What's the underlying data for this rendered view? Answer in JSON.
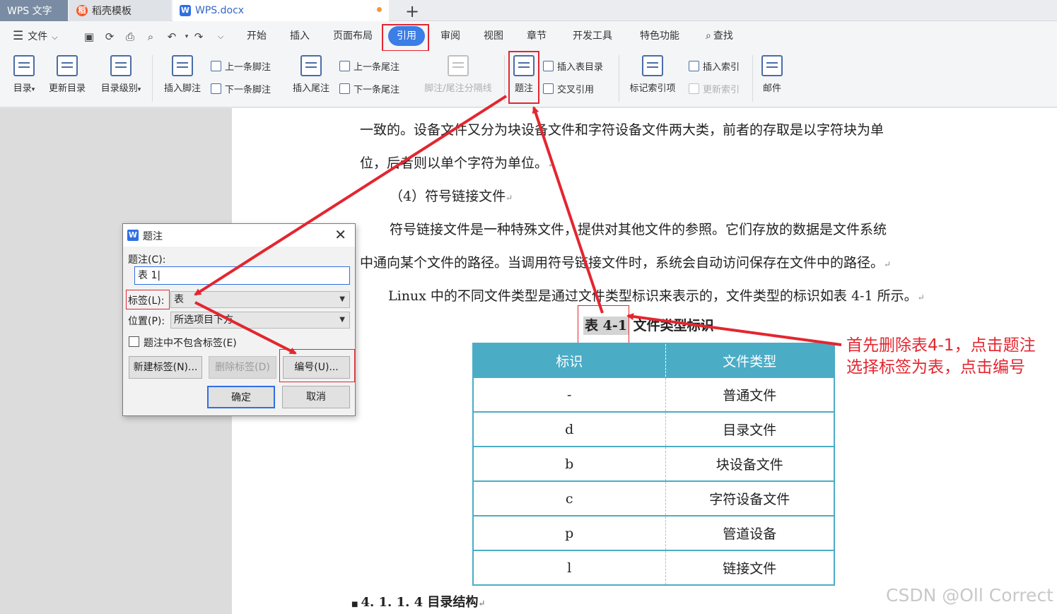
{
  "tabs": [
    {
      "label": "WPS 文字"
    },
    {
      "label": "稻壳模板"
    },
    {
      "label": "WPS.docx"
    }
  ],
  "menu": {
    "file": "文件",
    "items": [
      "开始",
      "插入",
      "页面布局",
      "引用",
      "审阅",
      "视图",
      "章节",
      "开发工具",
      "特色功能",
      "查找"
    ],
    "active": "引用"
  },
  "ribbon": {
    "toc": "目录",
    "update_toc": "更新目录",
    "toc_level": "目录级别",
    "insert_footnote": "插入脚注",
    "prev_footnote": "上一条脚注",
    "next_footnote": "下一条脚注",
    "insert_endnote": "插入尾注",
    "prev_endnote": "上一条尾注",
    "next_endnote": "下一条尾注",
    "separator": "脚注/尾注分隔线",
    "caption": "题注",
    "insert_table_toc": "插入表目录",
    "cross_ref": "交叉引用",
    "mark_index": "标记索引项",
    "insert_index": "插入索引",
    "update_index": "更新索引",
    "mail": "邮件"
  },
  "document": {
    "line1": "一致的。设备文件又分为块设备文件和字符设备文件两大类，前者的存取是以字符块为单",
    "line2": "位，后者则以单个字符为单位。",
    "line3": "（4）符号链接文件",
    "line4": "符号链接文件是一种特殊文件，提供对其他文件的参照。它们存放的数据是文件系统",
    "line5": "中通向某个文件的路径。当调用符号链接文件时，系统会自动访问保存在文件中的路径。",
    "line6": "Linux 中的不同文件类型是通过文件类型标识来表示的，文件类型的标识如表 4-1 所示。",
    "caption_num": "表 4-1",
    "caption_title": "文件类型标识",
    "table_headers": [
      "标识",
      "文件类型"
    ],
    "table_rows": [
      [
        "-",
        "普通文件"
      ],
      [
        "d",
        "目录文件"
      ],
      [
        "b",
        "块设备文件"
      ],
      [
        "c",
        "字符设备文件"
      ],
      [
        "p",
        "管道设备"
      ],
      [
        "l",
        "链接文件"
      ]
    ],
    "heading": "4. 1. 1. 4 目录结构"
  },
  "dialog": {
    "title": "题注",
    "caption_label": "题注(C):",
    "caption_value": "表 1",
    "label_label": "标签(L):",
    "label_value": "表",
    "position_label": "位置(P):",
    "position_value": "所选项目下方",
    "exclude_label": "题注中不包含标签(E)",
    "new_label": "新建标签(N)...",
    "delete_label": "删除标签(D)",
    "numbering": "编号(U)...",
    "ok": "确定",
    "cancel": "取消"
  },
  "annotation": {
    "line1": "首先删除表4-1，点击题注",
    "line2": "选择标签为表，点击编号"
  },
  "watermark": "CSDN @Oll Correct",
  "colors": {
    "accent": "#3c7de6",
    "annotation_red": "#e3262f",
    "table_header": "#4bacc6"
  }
}
